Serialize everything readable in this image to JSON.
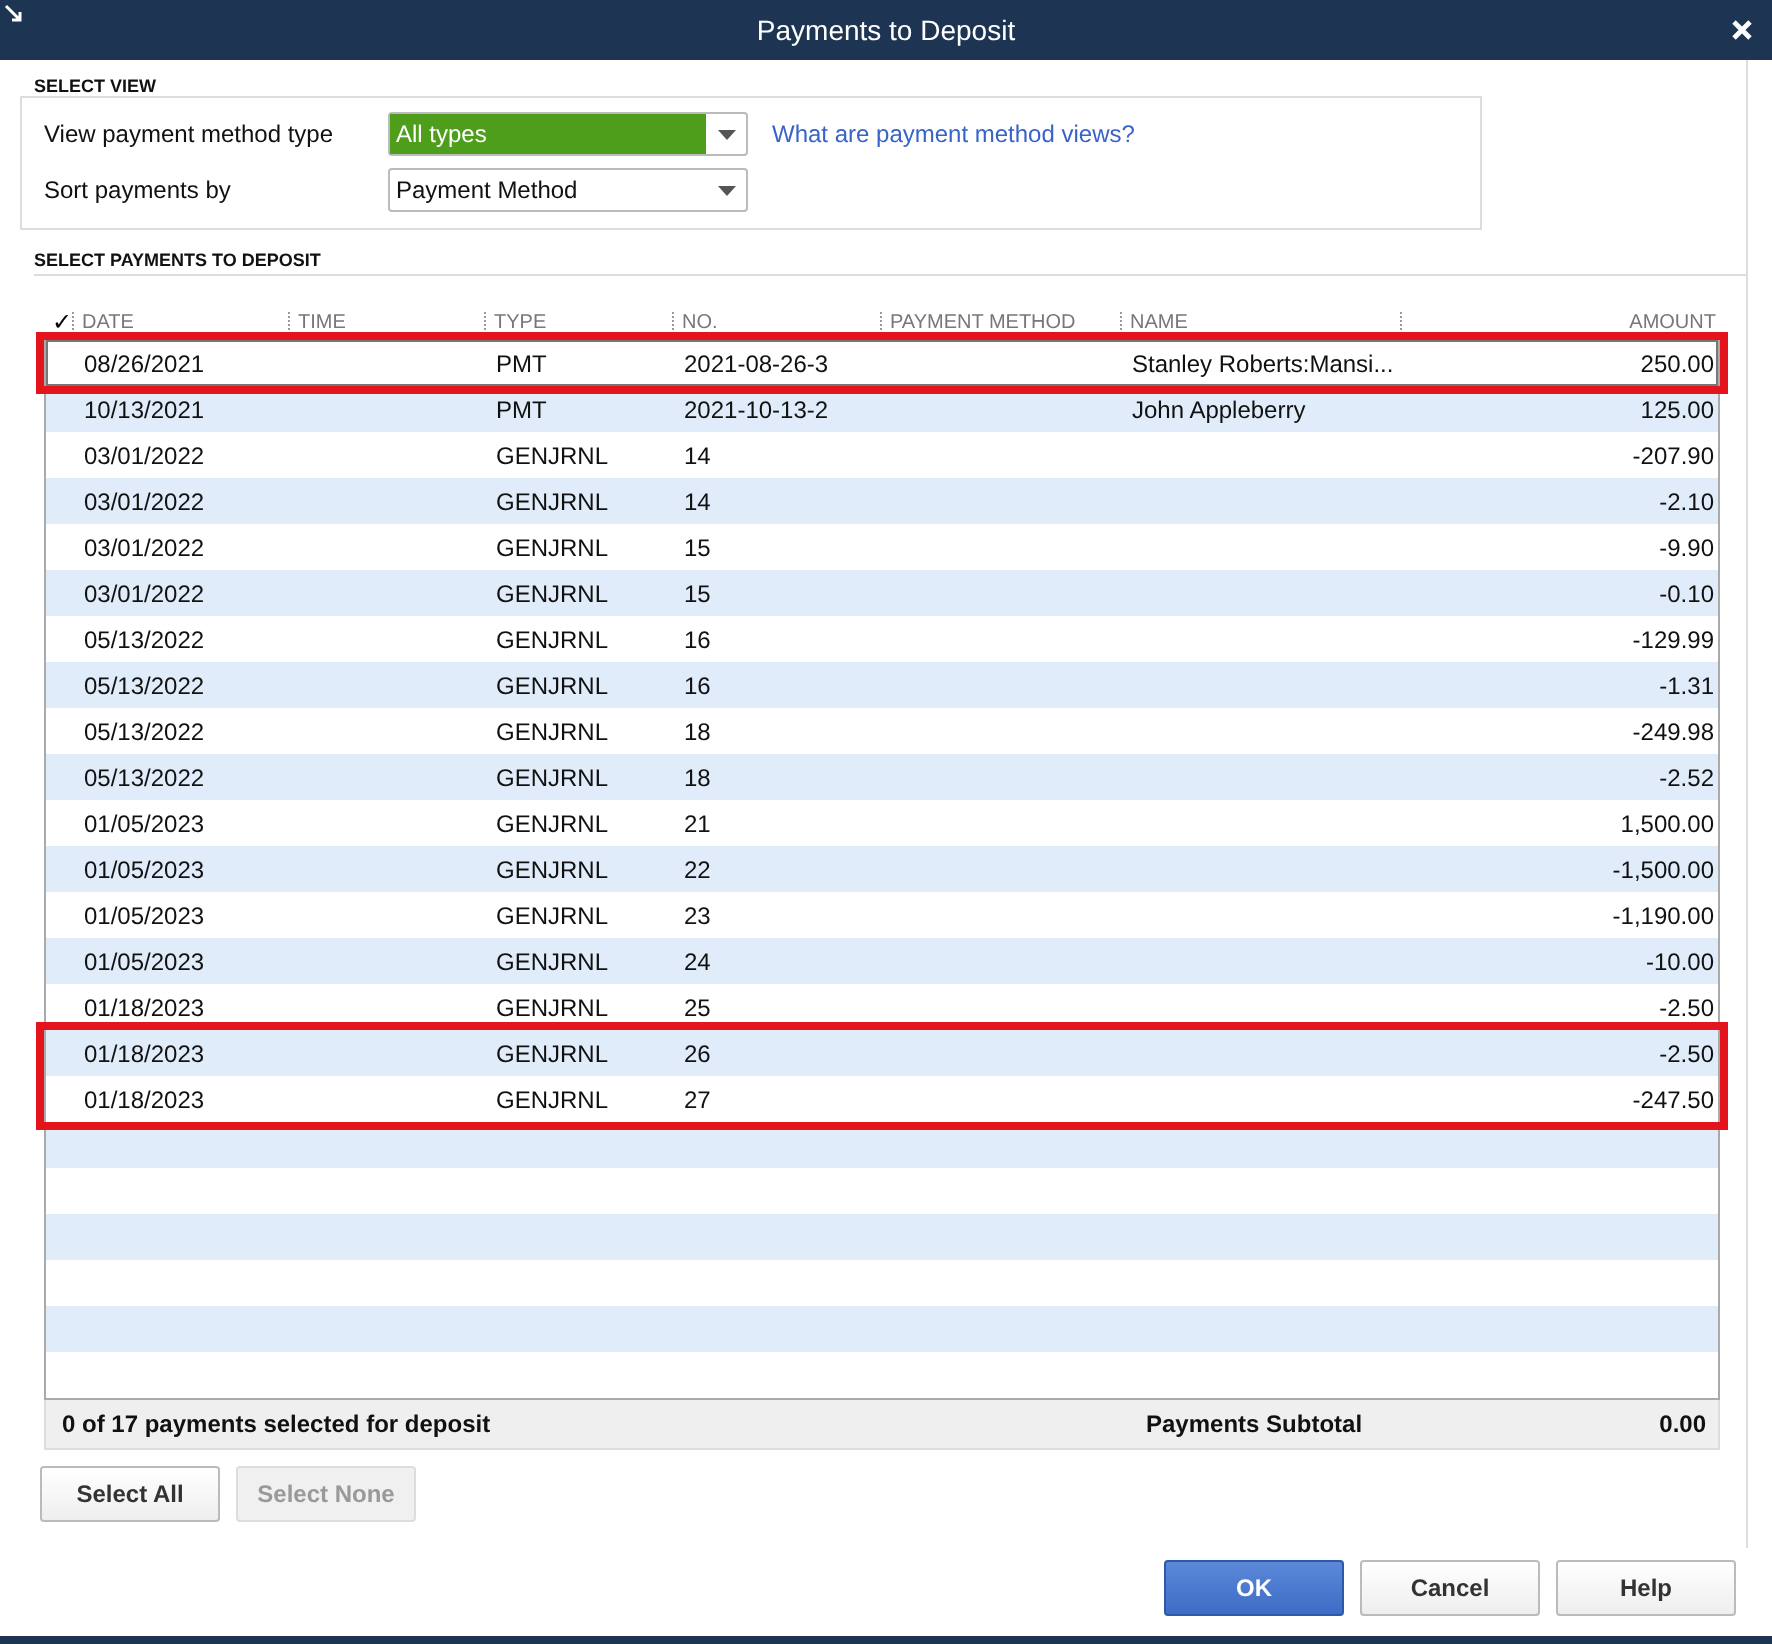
{
  "window": {
    "title": "Payments to Deposit"
  },
  "select_view": {
    "heading": "SELECT VIEW",
    "method_type": {
      "label": "View payment method type",
      "value": "All types"
    },
    "help_link": "What are payment method views?",
    "sort_by": {
      "label": "Sort payments by",
      "value": "Payment Method"
    }
  },
  "payments": {
    "heading": "SELECT PAYMENTS TO DEPOSIT",
    "check_column": "✓",
    "columns": [
      "DATE",
      "TIME",
      "TYPE",
      "NO.",
      "PAYMENT METHOD",
      "NAME",
      "AMOUNT"
    ],
    "rows": [
      {
        "date": "08/26/2021",
        "type": "PMT",
        "no": "2021-08-26-3",
        "name": "Stanley Roberts:Mansi...",
        "amount": "250.00",
        "selected": true,
        "highlighted": true
      },
      {
        "date": "10/13/2021",
        "type": "PMT",
        "no": "2021-10-13-2",
        "name": "John Appleberry",
        "amount": "125.00",
        "selected": false,
        "highlighted": false
      },
      {
        "date": "03/01/2022",
        "type": "GENJRNL",
        "no": "14",
        "amount": "-207.90",
        "selected": false,
        "highlighted": false
      },
      {
        "date": "03/01/2022",
        "type": "GENJRNL",
        "no": "14",
        "amount": "-2.10",
        "selected": false,
        "highlighted": false
      },
      {
        "date": "03/01/2022",
        "type": "GENJRNL",
        "no": "15",
        "amount": "-9.90",
        "selected": false,
        "highlighted": false
      },
      {
        "date": "03/01/2022",
        "type": "GENJRNL",
        "no": "15",
        "amount": "-0.10",
        "selected": false,
        "highlighted": false
      },
      {
        "date": "05/13/2022",
        "type": "GENJRNL",
        "no": "16",
        "amount": "-129.99",
        "selected": false,
        "highlighted": false
      },
      {
        "date": "05/13/2022",
        "type": "GENJRNL",
        "no": "16",
        "amount": "-1.31",
        "selected": false,
        "highlighted": false
      },
      {
        "date": "05/13/2022",
        "type": "GENJRNL",
        "no": "18",
        "amount": "-249.98",
        "selected": false,
        "highlighted": false
      },
      {
        "date": "05/13/2022",
        "type": "GENJRNL",
        "no": "18",
        "amount": "-2.52",
        "selected": false,
        "highlighted": false
      },
      {
        "date": "01/05/2023",
        "type": "GENJRNL",
        "no": "21",
        "amount": "1,500.00",
        "selected": false,
        "highlighted": false
      },
      {
        "date": "01/05/2023",
        "type": "GENJRNL",
        "no": "22",
        "amount": "-1,500.00",
        "selected": false,
        "highlighted": false
      },
      {
        "date": "01/05/2023",
        "type": "GENJRNL",
        "no": "23",
        "amount": "-1,190.00",
        "selected": false,
        "highlighted": false
      },
      {
        "date": "01/05/2023",
        "type": "GENJRNL",
        "no": "24",
        "amount": "-10.00",
        "selected": false,
        "highlighted": false
      },
      {
        "date": "01/18/2023",
        "type": "GENJRNL",
        "no": "25",
        "amount": "-2.50",
        "selected": false,
        "highlighted": false
      },
      {
        "date": "01/18/2023",
        "type": "GENJRNL",
        "no": "26",
        "amount": "-2.50",
        "selected": false,
        "highlighted": true
      },
      {
        "date": "01/18/2023",
        "type": "GENJRNL",
        "no": "27",
        "amount": "-247.50",
        "selected": false,
        "highlighted": true
      }
    ],
    "footer": {
      "count": "0 of 17 payments selected for deposit",
      "subtotal_label": "Payments Subtotal",
      "subtotal": "0.00"
    }
  },
  "select_buttons": [
    {
      "label": "Select All",
      "disabled": false
    },
    {
      "label": "Select None",
      "disabled": true
    }
  ],
  "buttons": [
    {
      "label": "OK",
      "primary": true
    },
    {
      "label": "Cancel",
      "primary": false
    },
    {
      "label": "Help",
      "primary": false
    }
  ]
}
